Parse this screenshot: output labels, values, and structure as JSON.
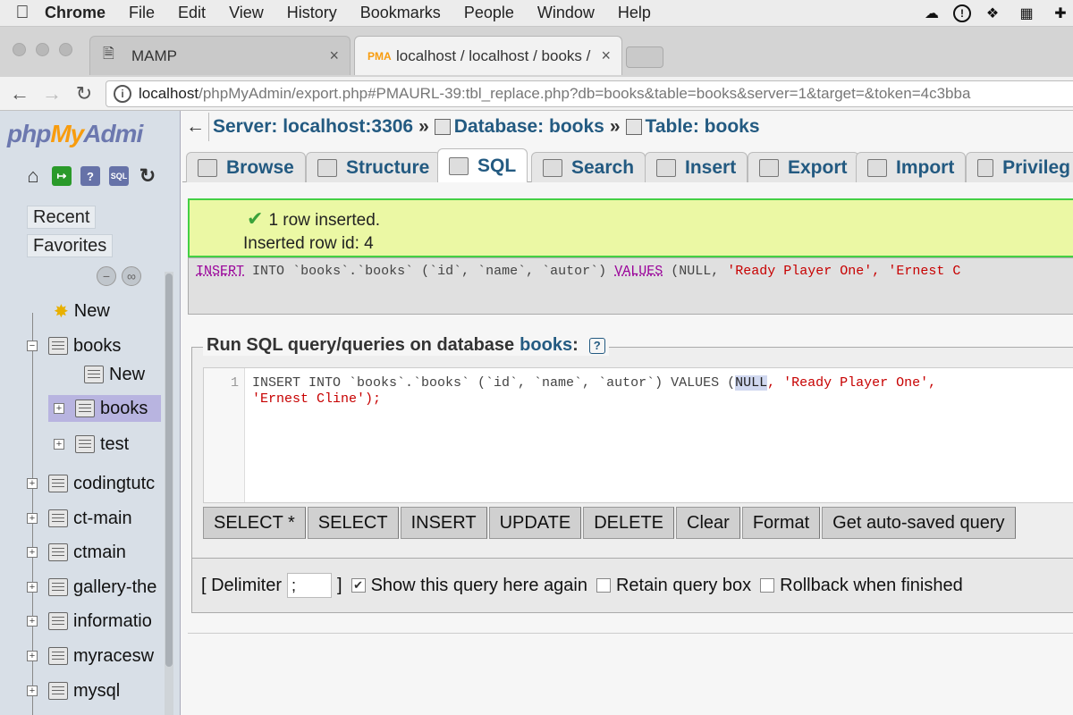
{
  "menubar": {
    "app": "Chrome",
    "items": [
      "File",
      "Edit",
      "View",
      "History",
      "Bookmarks",
      "People",
      "Window",
      "Help"
    ]
  },
  "browser": {
    "tabs": [
      {
        "title": "MAMP",
        "close": "×"
      },
      {
        "title": "localhost / localhost / books / l",
        "close": "×"
      }
    ],
    "url_host": "localhost",
    "url_rest": "/phpMyAdmin/export.php#PMAURL-39:tbl_replace.php?db=books&table=books&server=1&target=&token=4c3bba"
  },
  "sidebar": {
    "logo_php": "php",
    "logo_my": "My",
    "logo_admin": "Admi",
    "recent": "Recent",
    "favorites": "Favorites",
    "tree": [
      {
        "label": "New"
      },
      {
        "label": "books"
      },
      {
        "label": "New"
      },
      {
        "label": "books"
      },
      {
        "label": "test"
      },
      {
        "label": "codingtutc"
      },
      {
        "label": "ct-main"
      },
      {
        "label": "ctmain"
      },
      {
        "label": "gallery-the"
      },
      {
        "label": "informatio"
      },
      {
        "label": "myracesw"
      },
      {
        "label": "mysql"
      }
    ]
  },
  "breadcrumb": {
    "server": "Server: localhost:3306",
    "database": "Database: books",
    "table": "Table: books",
    "sep": "»"
  },
  "tabs": [
    "Browse",
    "Structure",
    "SQL",
    "Search",
    "Insert",
    "Export",
    "Import",
    "Privileg"
  ],
  "message": {
    "line1": "1 row inserted.",
    "line2": "Inserted row id: 4"
  },
  "sql_echo": {
    "insert": "INSERT",
    "into": "INTO",
    "table": "`books`.`books`",
    "cols_open": "(`id`,",
    "col2": "`name`,",
    "col3": "`autor`)",
    "values": "VALUES",
    "null": "(NULL,",
    "s1": "'Ready Player One',",
    "s2": "'Ernest C"
  },
  "query_box": {
    "legend": "Run SQL query/queries on database",
    "db": "books",
    "colon": ":",
    "line_number": "1",
    "line1_a": "INSERT INTO `books`.`books` (`id`, `name`, `autor`) VALUES (",
    "line1_null": "NULL",
    "line1_b": ", 'Ready Player One',",
    "line2": "'Ernest Cline');"
  },
  "buttons": [
    "SELECT *",
    "SELECT",
    "INSERT",
    "UPDATE",
    "DELETE",
    "Clear",
    "Format",
    "Get auto-saved query"
  ],
  "options": {
    "delimiter_label": "[ Delimiter",
    "delimiter_value": ";",
    "delimiter_close": "]",
    "show_query": "Show this query here again",
    "retain": "Retain query box",
    "rollback": "Rollback when finished"
  },
  "colors": {
    "link": "#235a81",
    "success_bg": "#ebf8a4",
    "success_border": "#44d044"
  }
}
